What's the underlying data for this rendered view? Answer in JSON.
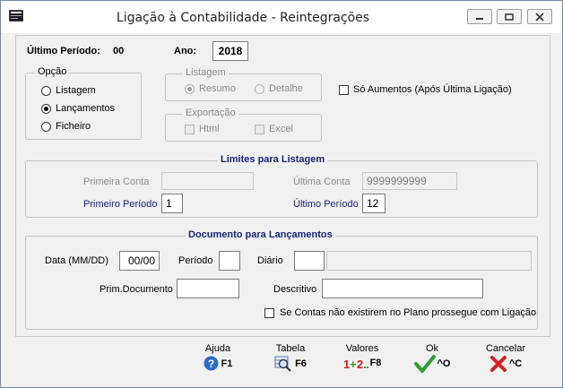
{
  "window": {
    "title": "Ligação à Contabilidade - Reintegrações",
    "controls": [
      "minimize",
      "restore",
      "close"
    ]
  },
  "header": {
    "ultimo_periodo_label": "Último Período:",
    "ultimo_periodo_value": "00",
    "ano_label": "Ano:",
    "ano_value": "2018"
  },
  "opcao": {
    "title": "Opção",
    "options": [
      "Listagem",
      "Lançamentos",
      "Ficheiro"
    ],
    "selected": "Lançamentos"
  },
  "listagem": {
    "title": "Listagem",
    "options": [
      "Resumo",
      "Detalhe"
    ],
    "selected": "Resumo"
  },
  "exportacao": {
    "title": "Exportação",
    "options": [
      "Html",
      "Excel"
    ]
  },
  "so_aumentos_label": "Só Aumentos (Após Última Ligação)",
  "limites": {
    "title": "Limites para Listagem",
    "primeira_conta_label": "Primeira Conta",
    "primeira_conta_value": "",
    "ultima_conta_label": "Última Conta",
    "ultima_conta_value": "9999999999",
    "primeiro_periodo_label": "Primeiro Período",
    "primeiro_periodo_value": "1",
    "ultimo_periodo_label": "Último Período",
    "ultimo_periodo_value": "12"
  },
  "documento": {
    "title": "Documento para Lançamentos",
    "data_label": "Data (MM/DD)",
    "data_value": "00/00",
    "periodo_label": "Período",
    "periodo_value": "",
    "diario_label": "Diário",
    "diario_code": "",
    "diario_desc": "",
    "prim_documento_label": "Prim.Documento",
    "prim_documento_value": "",
    "descritivo_label": "Descritivo",
    "descritivo_value": "",
    "contas_checkbox_label": "Se Contas não existirem no Plano prossegue com Ligação"
  },
  "footer": {
    "buttons": [
      {
        "label": "Ajuda",
        "key": "F1",
        "icon": "help-icon"
      },
      {
        "label": "Tabela",
        "key": "F6",
        "icon": "magnifier-table-icon"
      },
      {
        "label": "Valores",
        "key": "F8",
        "icon": "values-icon"
      },
      {
        "label": "Ok",
        "key": "^O",
        "icon": "checkmark-icon"
      },
      {
        "label": "Cancelar",
        "key": "^C",
        "icon": "cross-icon"
      }
    ]
  },
  "colors": {
    "accent_blue": "#1a237e",
    "ok_green": "#2e9d2e",
    "cancel_red": "#d32020",
    "help_blue": "#2b6cc4"
  }
}
